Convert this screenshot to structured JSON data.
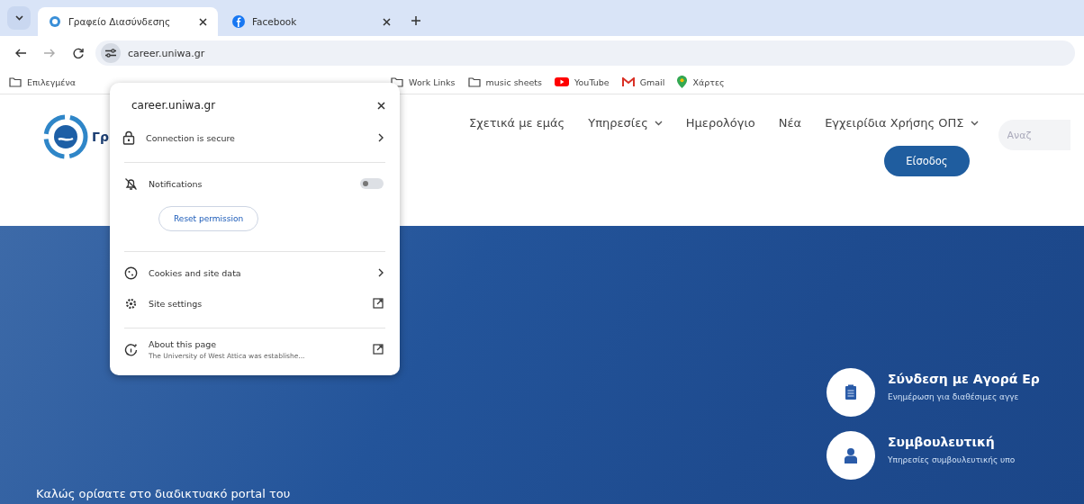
{
  "tabs": [
    {
      "title": "Γραφείο Διασύνδεσης",
      "selected": true
    },
    {
      "title": "Facebook",
      "selected": false
    }
  ],
  "address": "career.uniwa.gr",
  "bookmarks": [
    {
      "label": "Επιλεγμένα",
      "kind": "folder"
    },
    {
      "label": "Work Links",
      "kind": "folder"
    },
    {
      "label": "music sheets",
      "kind": "folder"
    },
    {
      "label": "YouTube",
      "kind": "youtube"
    },
    {
      "label": "Gmail",
      "kind": "gmail"
    },
    {
      "label": "Χάρτες",
      "kind": "maps"
    }
  ],
  "site": {
    "logo_text": "Γρ",
    "nav": [
      {
        "label": "Σχετικά με εμάς",
        "dropdown": false
      },
      {
        "label": "Υπηρεσίες",
        "dropdown": true
      },
      {
        "label": "Ημερολόγιο",
        "dropdown": false
      },
      {
        "label": "Νέα",
        "dropdown": false
      },
      {
        "label": "Εγχειρίδια Χρήσης ΟΠΣ",
        "dropdown": true
      }
    ],
    "search_placeholder": "Αναζ",
    "login": "Είσοδος",
    "services": [
      {
        "title": "Σύνδεση με Αγορά Ερ",
        "text": "Ενημέρωση για διαθέσιμες αγγε"
      },
      {
        "title": "Συμβουλευτική",
        "text": "Υπηρεσίες συμβουλευτικής υπο"
      }
    ],
    "welcome": "Καλώς ορίσατε στο διαδικτυακό portal του"
  },
  "popup": {
    "title": "career.uniwa.gr",
    "sections": [
      [
        {
          "kind": "link",
          "label": "Connection is secure"
        }
      ],
      [
        {
          "kind": "toggle",
          "label": "Notifications",
          "on": false
        },
        {
          "kind": "button",
          "label": "Reset permission"
        }
      ],
      [
        {
          "kind": "link",
          "label": "Cookies and site data"
        },
        {
          "kind": "external",
          "label": "Site settings"
        }
      ],
      [
        {
          "kind": "external",
          "label": "About this page",
          "sub": "The University of West Attica was establishe..."
        }
      ]
    ]
  }
}
